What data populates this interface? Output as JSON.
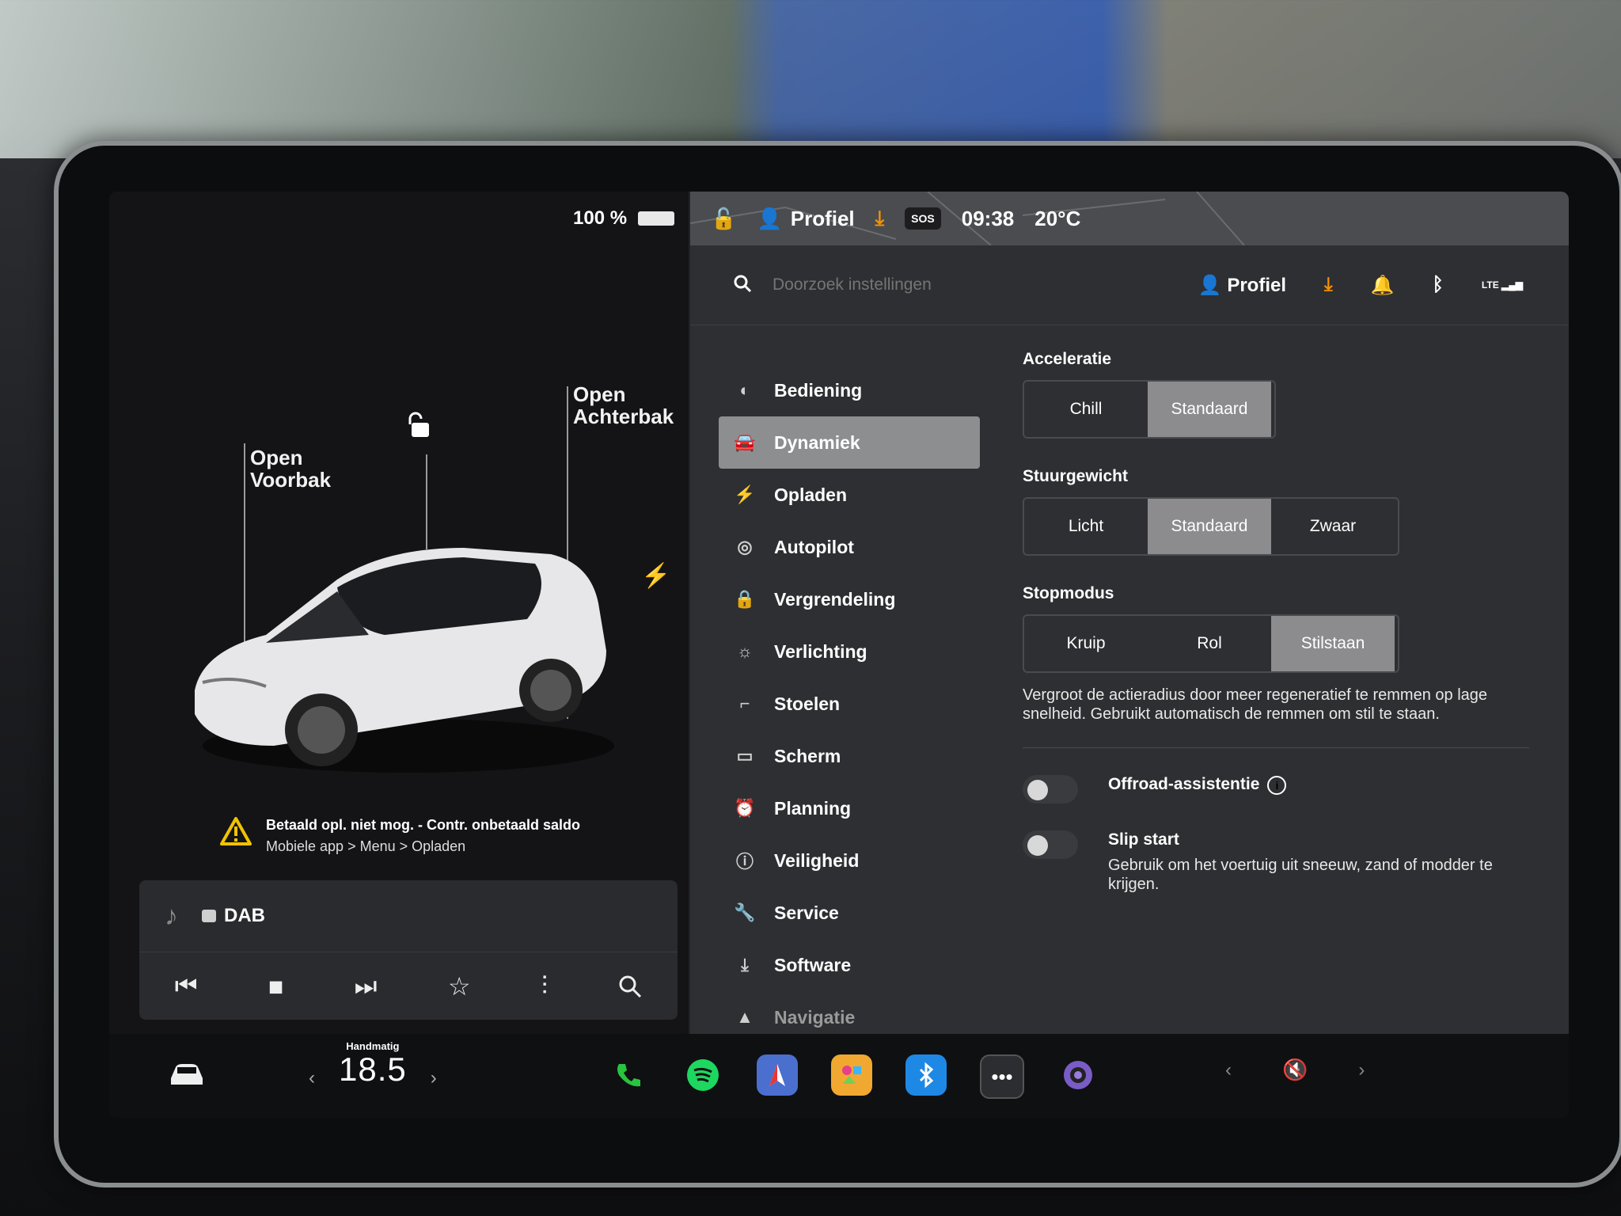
{
  "status": {
    "battery": "100 %",
    "profile": "Profiel",
    "sos": "SOS",
    "time": "09:38",
    "temperature": "20°C"
  },
  "car_panel": {
    "frunk_label_1": "Open",
    "frunk_label_2": "Voorbak",
    "trunk_label_1": "Open",
    "trunk_label_2": "Achterbak",
    "alert_title": "Betaald opl. niet mog. - Contr. onbetaald saldo",
    "alert_sub": "Mobiele app > Menu > Opladen"
  },
  "media": {
    "source": "DAB"
  },
  "settings_header": {
    "search_placeholder": "Doorzoek instellingen",
    "profile": "Profiel",
    "network": "LTE"
  },
  "nav": {
    "items": [
      {
        "label": "Bediening",
        "icon": "toggle-icon"
      },
      {
        "label": "Dynamiek",
        "icon": "car-icon",
        "active": true
      },
      {
        "label": "Opladen",
        "icon": "bolt-icon"
      },
      {
        "label": "Autopilot",
        "icon": "steering-wheel-icon"
      },
      {
        "label": "Vergrendeling",
        "icon": "lock-icon"
      },
      {
        "label": "Verlichting",
        "icon": "sun-icon"
      },
      {
        "label": "Stoelen",
        "icon": "seat-icon"
      },
      {
        "label": "Scherm",
        "icon": "display-icon"
      },
      {
        "label": "Planning",
        "icon": "alarm-clock-icon"
      },
      {
        "label": "Veiligheid",
        "icon": "info-icon"
      },
      {
        "label": "Service",
        "icon": "wrench-icon"
      },
      {
        "label": "Software",
        "icon": "download-icon"
      },
      {
        "label": "Navigatie",
        "icon": "navigation-arrow-icon"
      }
    ]
  },
  "dynamics": {
    "acceleration": {
      "title": "Acceleratie",
      "options": [
        "Chill",
        "Standaard"
      ],
      "selected": "Standaard"
    },
    "steering": {
      "title": "Stuurgewicht",
      "options": [
        "Licht",
        "Standaard",
        "Zwaar"
      ],
      "selected": "Standaard"
    },
    "stop_mode": {
      "title": "Stopmodus",
      "options": [
        "Kruip",
        "Rol",
        "Stilstaan"
      ],
      "selected": "Stilstaan",
      "description": "Vergroot de actieradius door meer regeneratief te remmen op lage snelheid. Gebruikt automatisch de remmen om stil te staan."
    },
    "offroad": {
      "label": "Offroad-assistentie",
      "on": false
    },
    "slip_start": {
      "label": "Slip start",
      "description": "Gebruik om het voertuig uit sneeuw, zand of modder te krijgen.",
      "on": false
    }
  },
  "bottom_bar": {
    "climate_mode": "Handmatig",
    "climate_temp": "18.5",
    "apps": [
      "phone-icon",
      "spotify-icon",
      "navigation-app-icon",
      "toybox-icon",
      "bluetooth-icon",
      "more-apps-icon",
      "camera-icon"
    ]
  },
  "colors": {
    "accent_orange": "#f39200",
    "selected_segment": "#8c8c8e",
    "active_nav": "#8d8e90"
  }
}
